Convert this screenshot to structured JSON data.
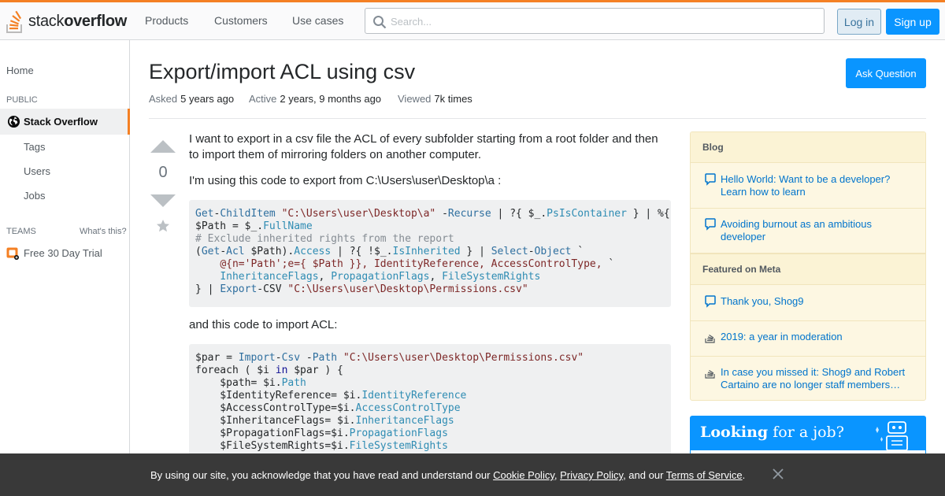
{
  "header": {
    "logo_text_light": "stack",
    "logo_text_bold": "overflow",
    "nav": [
      "Products",
      "Customers",
      "Use cases"
    ],
    "search_placeholder": "Search...",
    "login_label": "Log in",
    "signup_label": "Sign up",
    "accent": "#f48024"
  },
  "sidebar": {
    "home": "Home",
    "public_label": "PUBLIC",
    "active_item": "Stack Overflow",
    "sub_items": [
      "Tags",
      "Users",
      "Jobs"
    ],
    "teams_label": "TEAMS",
    "whats_this": "What's this?",
    "free_trial": "Free 30 Day Trial"
  },
  "question": {
    "title": "Export/import ACL using csv",
    "ask_button": "Ask Question",
    "asked_label": "Asked",
    "asked_value": "5 years ago",
    "active_label": "Active",
    "active_value": "2 years, 9 months ago",
    "viewed_label": "Viewed",
    "viewed_value": "7k times",
    "votes": "0",
    "para1": "I want to export in a csv file the ACL of every subfolder starting from a root folder and then to import them of mirroring folders on another computer.",
    "para2": "I'm using this code to export from C:\\Users\\user\\Desktop\\a :",
    "para3": "and this code to import ACL:"
  },
  "blog_widget": {
    "blog_heading": "Blog",
    "blog_items": [
      "Hello World: Want to be a developer? Learn how to learn",
      "Avoiding burnout as an ambitious developer"
    ],
    "meta_heading": "Featured on Meta",
    "meta_items": [
      "Thank you, Shog9",
      "2019: a year in moderation",
      "In case you missed it: Shog9 and Robert Cartaino are no longer staff members…"
    ]
  },
  "job_ad": {
    "bold": "Looking",
    "rest": "for a job?"
  },
  "cookie_banner": {
    "prefix": "By using our site, you acknowledge that you have read and understand our",
    "cookie_policy": "Cookie Policy",
    "sep1": ",",
    "privacy_policy": "Privacy Policy",
    "sep2": ", and our",
    "terms": "Terms of Service",
    "suffix": "."
  }
}
